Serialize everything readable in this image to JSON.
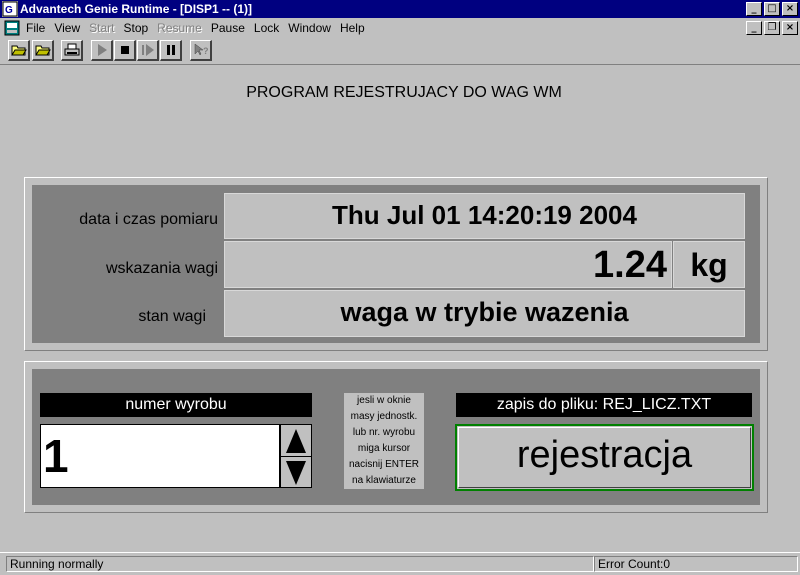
{
  "window": {
    "title": "Advantech Genie Runtime - [DISP1 -- (1)]",
    "minimize_glyph": "_",
    "maximize_glyph": "□",
    "close_glyph": "×",
    "restore_glyph": "❐"
  },
  "menu": {
    "items": [
      {
        "label": "File",
        "enabled": true
      },
      {
        "label": "View",
        "enabled": true
      },
      {
        "label": "Start",
        "enabled": false
      },
      {
        "label": "Stop",
        "enabled": true
      },
      {
        "label": "Resume",
        "enabled": false
      },
      {
        "label": "Pause",
        "enabled": true
      },
      {
        "label": "Lock",
        "enabled": true
      },
      {
        "label": "Window",
        "enabled": true
      },
      {
        "label": "Help",
        "enabled": true
      }
    ]
  },
  "toolbar": {
    "buttons": [
      "open-folder-icon",
      "open-display-icon",
      "print-icon",
      "play-icon",
      "stop-icon",
      "step-icon",
      "pause-icon",
      "help-pointer-icon"
    ]
  },
  "heading": "PROGRAM REJESTRUJACY DO WAG WM",
  "measurement": {
    "datetime_label": "data i czas pomiaru",
    "datetime_value": "Thu Jul 01 14:20:19 2004",
    "weight_label": "wskazania wagi",
    "weight_value": "1.24",
    "weight_unit": "kg",
    "state_label": "stan wagi",
    "state_value": "waga  w trybie wazenia"
  },
  "product": {
    "header": "numer wyrobu",
    "value": "1"
  },
  "note": {
    "lines": [
      "jesli w oknie",
      "masy jednostk.",
      "lub nr. wyrobu",
      "miga kursor",
      "nacisnij ENTER",
      "na klawiaturze"
    ]
  },
  "file": {
    "header": "zapis do pliku: REJ_LICZ.TXT",
    "button_label": "rejestracja"
  },
  "status": {
    "left": "Running normally",
    "right": "Error Count:0"
  },
  "colors": {
    "titlebar": "#000080",
    "panel_bg": "#808080",
    "button_border": "#008000"
  }
}
